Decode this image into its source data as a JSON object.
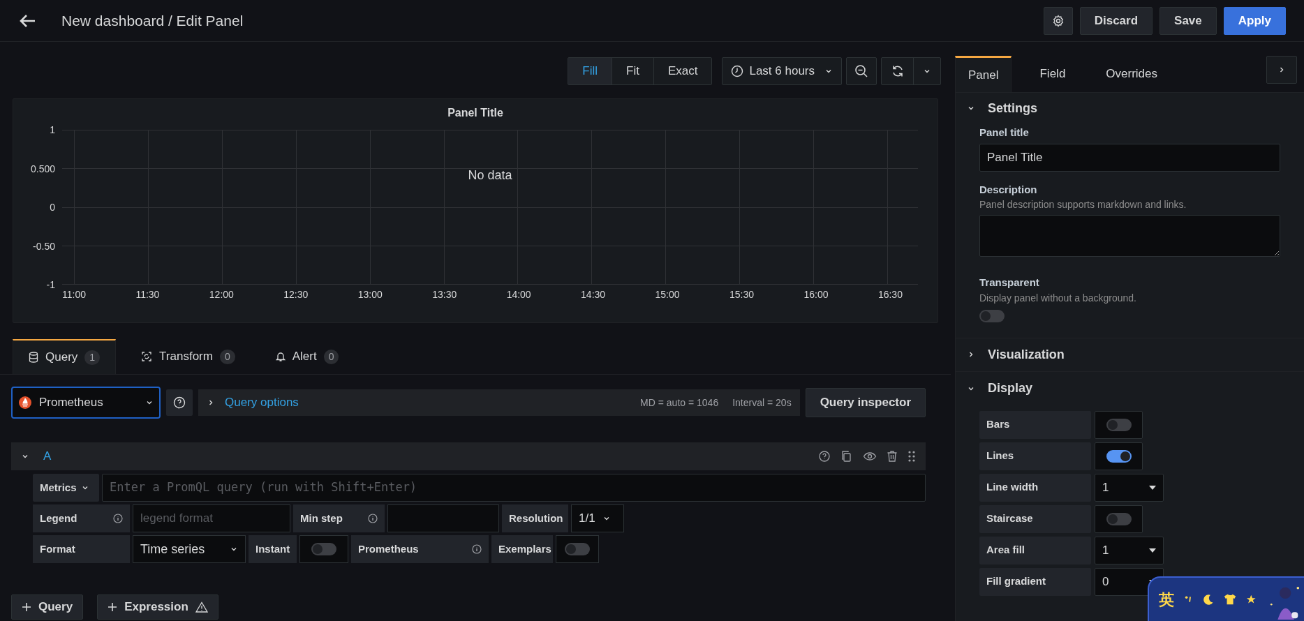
{
  "header": {
    "title": "New dashboard / Edit Panel",
    "buttons": [
      {
        "label": "Discard",
        "kind": "secondary"
      },
      {
        "label": "Save",
        "kind": "secondary"
      },
      {
        "label": "Apply",
        "kind": "primary"
      }
    ]
  },
  "view_modes": [
    {
      "label": "Fill",
      "selected": true
    },
    {
      "label": "Fit",
      "selected": false
    },
    {
      "label": "Exact",
      "selected": false
    }
  ],
  "time_range": "Last 6 hours",
  "panel": {
    "title": "Panel Title",
    "message": "No data",
    "y_labels": [
      "1",
      "0.500",
      "0",
      "-0.50",
      "-1"
    ],
    "x_labels": [
      "11:00",
      "11:30",
      "12:00",
      "12:30",
      "13:00",
      "13:30",
      "14:00",
      "14:30",
      "15:00",
      "15:30",
      "16:00",
      "16:30"
    ]
  },
  "query_tabs": [
    {
      "label": "Query",
      "count": "1",
      "selected": true
    },
    {
      "label": "Transform",
      "count": "0",
      "selected": false
    },
    {
      "label": "Alert",
      "count": "0",
      "selected": false
    }
  ],
  "datasource": "Prometheus",
  "query_options": {
    "label": "Query options",
    "md": "MD = auto = 1046",
    "interval": "Interval = 20s"
  },
  "query_inspector": "Query inspector",
  "query": {
    "ref": "A",
    "expanded": true,
    "metrics_label": "Metrics",
    "metrics_placeholder": "Enter a PromQL query (run with Shift+Enter)",
    "legend_label": "Legend",
    "legend_placeholder": "legend format",
    "min_step_label": "Min step",
    "resolution_label": "Resolution",
    "resolution": "1/1",
    "format_label": "Format",
    "format": "Time series",
    "instant_label": "Instant",
    "instant": false,
    "prometheus_label": "Prometheus",
    "exemplars_label": "Exemplars",
    "exemplars": false
  },
  "add_buttons": [
    {
      "label": "Query",
      "warning": false
    },
    {
      "label": "Expression",
      "warning": true
    }
  ],
  "options_tabs": [
    {
      "label": "Panel",
      "selected": true
    },
    {
      "label": "Field",
      "selected": false
    },
    {
      "label": "Overrides",
      "selected": false
    }
  ],
  "settings": {
    "title": "Settings",
    "expanded": true,
    "panel_title_label": "Panel title",
    "panel_title": "Panel Title",
    "description_label": "Description",
    "description_hint": "Panel description supports markdown and links.",
    "transparent_label": "Transparent",
    "transparent_hint": "Display panel without a background.",
    "transparent": false
  },
  "visualization": {
    "title": "Visualization",
    "expanded": false
  },
  "display": {
    "title": "Display",
    "expanded": true,
    "rows": [
      {
        "label": "Bars",
        "kind": "switch",
        "on": false
      },
      {
        "label": "Lines",
        "kind": "switch",
        "on": true
      },
      {
        "label": "Line width",
        "kind": "select",
        "value": "1"
      },
      {
        "label": "Staircase",
        "kind": "switch",
        "on": false
      },
      {
        "label": "Area fill",
        "kind": "select",
        "value": "1"
      },
      {
        "label": "Fill gradient",
        "kind": "select",
        "value": "0"
      }
    ]
  },
  "ime": {
    "label": "英"
  }
}
